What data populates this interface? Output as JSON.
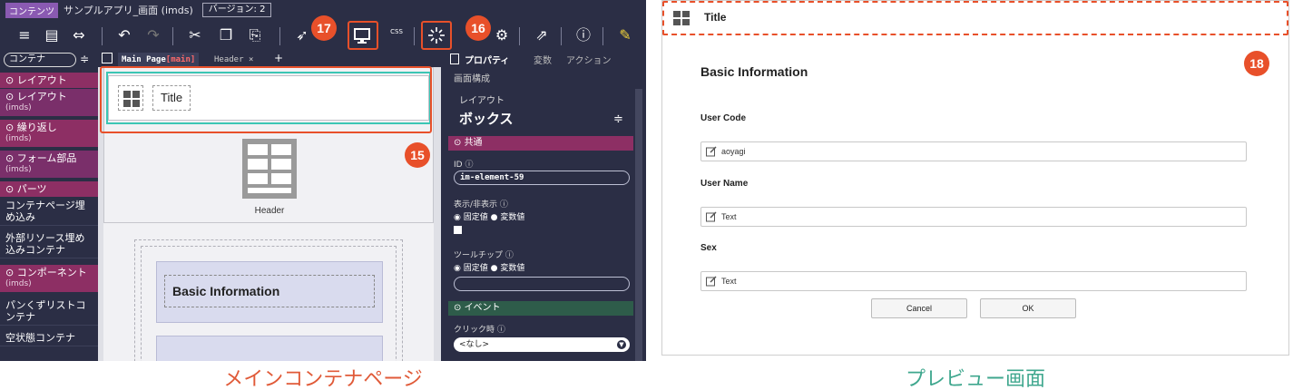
{
  "editor": {
    "title_tag": "コンテンツ",
    "app_name": "サンプルアプリ_画面 (imds)",
    "version": "バージョン: 2",
    "toolbar_css_label": "CSS",
    "palette": {
      "search": "コンテナ",
      "items": [
        {
          "label": "レイアウト",
          "sub": ""
        },
        {
          "label": "レイアウト",
          "sub": "(imds)"
        },
        {
          "label": "繰り返し",
          "sub": "(imds)"
        },
        {
          "label": "フォーム部品",
          "sub": "(imds)"
        },
        {
          "label": "パーツ",
          "sub": ""
        },
        {
          "label": "コンテナページ埋め込み",
          "sub": ""
        },
        {
          "label": "外部リソース埋め込みコンテナ",
          "sub": ""
        },
        {
          "label": "コンポーネント",
          "sub": "(imds)"
        },
        {
          "label": "パンくずリストコンテナ",
          "sub": ""
        },
        {
          "label": "空状態コンテナ",
          "sub": ""
        }
      ]
    },
    "tabs": {
      "main": "Main Page",
      "main_suffix": "[main]",
      "header": "Header",
      "close": "×",
      "add": "+"
    },
    "canvas": {
      "title_label": "Title",
      "header_label": "Header",
      "basic_info": "Basic Information"
    },
    "props": {
      "tabs": [
        "プロパティ",
        "変数",
        "アクション"
      ],
      "subtitle": "画面構成",
      "layout_label": "レイアウト",
      "layout_value": "ボックス",
      "section_common": "共通",
      "id_label": "ID",
      "id_value": "im-element-59",
      "visibility_label": "表示/非表示",
      "fixed": "固定値",
      "variable": "変数値",
      "tooltip_label": "ツールチップ",
      "section_event": "イベント",
      "click_label": "クリック時",
      "click_value": "<なし>"
    },
    "badges": {
      "b15": "15",
      "b16": "16",
      "b17": "17"
    }
  },
  "preview": {
    "badge": "18",
    "title": "Title",
    "heading": "Basic Information",
    "fields": [
      {
        "label": "User Code",
        "value": "aoyagi"
      },
      {
        "label": "User Name",
        "value": "Text"
      },
      {
        "label": "Sex",
        "value": "Text"
      }
    ],
    "cancel": "Cancel",
    "ok": "OK"
  },
  "captions": {
    "left": "メインコンテナページ",
    "right": "プレビュー画面"
  },
  "colors": {
    "accent": "#e8502a",
    "editor_bg": "#2b2e45",
    "teal": "#3cc6b4",
    "caption_left": "#e05a38",
    "caption_right": "#3fa78e"
  }
}
